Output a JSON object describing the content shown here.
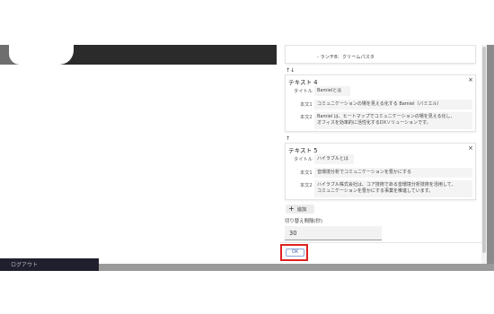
{
  "background": {
    "header_text": "",
    "sidebar_text": "ログアウト"
  },
  "dialog": {
    "prev_card": {
      "item": "- ランチB：クリームパスタ"
    },
    "card4": {
      "arrows": "↑↓",
      "title": "テキスト 4",
      "title_label": "タイトル",
      "title_value": "Bamielとは",
      "body1_label": "本文1",
      "body1_value": "コミュニケーションの場を見える化する Bamiel（バミエル）",
      "body2_label": "本文2",
      "body2_line1": "Bamiel は、ヒートマップでコミュニケーションの場を見える化し、",
      "body2_line2": "オフィスを効率的に活性化するDXソリューションです。"
    },
    "card5": {
      "arrows": "↑",
      "title": "テキスト 5",
      "title_label": "タイトル",
      "title_value": "ハイラブルとは",
      "body1_label": "本文1",
      "body1_value": "音環境分析でコミュニケーションを豊かにする",
      "body2_label": "本文2",
      "body2_line1": "ハイラブル株式会社は、コア技術である音環境分析技術を活用して、",
      "body2_line2": "コミュニケーションを豊かにする事業を推進しています。"
    },
    "close_glyph": "×",
    "add_label": "追加",
    "add_glyph": "+",
    "interval_label": "切り替え間隔(秒)",
    "interval_value": "30",
    "ok_label": "OK"
  },
  "colors": {
    "highlight": "#e02020",
    "ok_border": "#8aa8d8",
    "ok_text": "#3a5fa8"
  }
}
